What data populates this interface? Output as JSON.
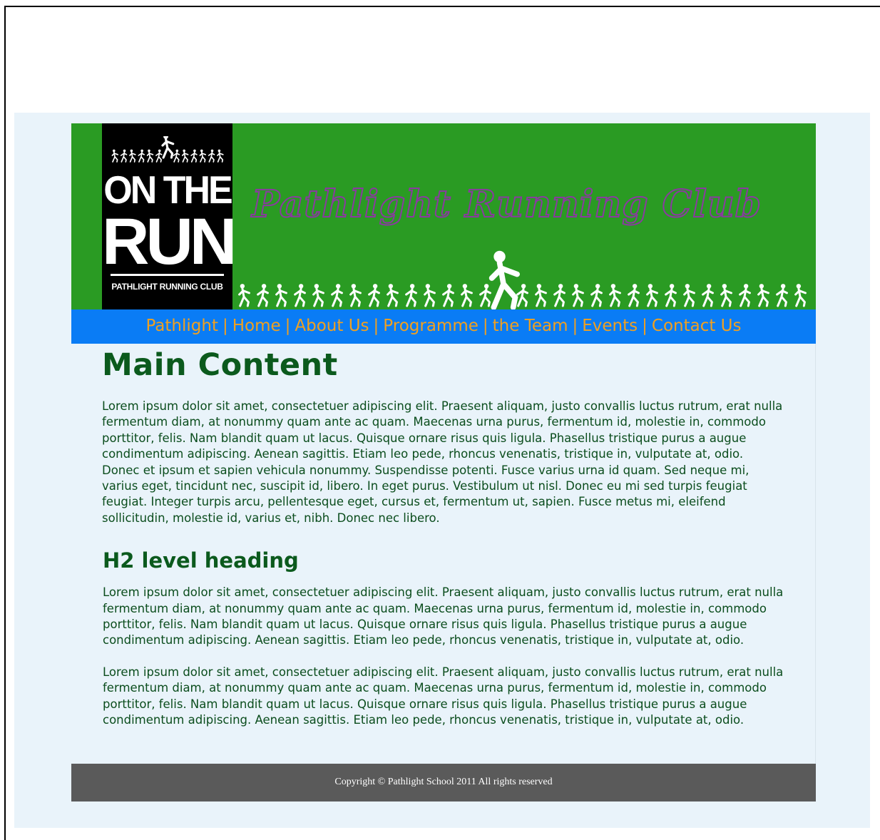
{
  "logo": {
    "line1": "ON THE",
    "line2": "RUN",
    "subtitle": "PATHLIGHT RUNNING CLUB"
  },
  "header": {
    "title": "Pathlight Running Club"
  },
  "nav": {
    "items": [
      {
        "label": "Pathlight"
      },
      {
        "label": "Home"
      },
      {
        "label": "About Us"
      },
      {
        "label": "Programme"
      },
      {
        "label": "the Team"
      },
      {
        "label": "Events"
      },
      {
        "label": "Contact Us"
      }
    ],
    "separator": "|"
  },
  "main": {
    "heading": "Main Content",
    "paragraph1": "Lorem ipsum dolor sit amet, consectetuer adipiscing elit. Praesent aliquam, justo convallis luctus rutrum, erat nulla fermentum diam, at nonummy quam ante ac quam. Maecenas urna purus, fermentum id, molestie in, commodo porttitor, felis. Nam blandit quam ut lacus. Quisque ornare risus quis ligula. Phasellus tristique purus a augue condimentum adipiscing. Aenean sagittis. Etiam leo pede, rhoncus venenatis, tristique in, vulputate at, odio. Donec et ipsum et sapien vehicula nonummy. Suspendisse potenti. Fusce varius urna id quam. Sed neque mi, varius eget, tincidunt nec, suscipit id, libero. In eget purus. Vestibulum ut nisl. Donec eu mi sed turpis feugiat feugiat. Integer turpis arcu, pellentesque eget, cursus et, fermentum ut, sapien. Fusce metus mi, eleifend sollicitudin, molestie id, varius et, nibh. Donec nec libero.",
    "subheading": "H2 level heading",
    "paragraph2": "Lorem ipsum dolor sit amet, consectetuer adipiscing elit. Praesent aliquam, justo convallis luctus rutrum, erat nulla fermentum diam, at nonummy quam ante ac quam. Maecenas urna purus, fermentum id, molestie in, commodo porttitor, felis. Nam blandit quam ut lacus. Quisque ornare risus quis ligula. Phasellus tristique purus a augue condimentum adipiscing. Aenean sagittis. Etiam leo pede, rhoncus venenatis, tristique in, vulputate at, odio.",
    "paragraph3": "Lorem ipsum dolor sit amet, consectetuer adipiscing elit. Praesent aliquam, justo convallis luctus rutrum, erat nulla fermentum diam, at nonummy quam ante ac quam. Maecenas urna purus, fermentum id, molestie in, commodo porttitor, felis. Nam blandit quam ut lacus. Quisque ornare risus quis ligula. Phasellus tristique purus a augue condimentum adipiscing. Aenean sagittis. Etiam leo pede, rhoncus venenatis, tristique in, vulputate at, odio."
  },
  "footer": {
    "copyright": "Copyright © Pathlight School 2011 All rights reserved"
  },
  "colors": {
    "header_green": "#2a9b23",
    "nav_blue": "#0a7cf5",
    "nav_text": "#f0a020",
    "title_outline": "#8a3aa0",
    "text_green": "#0b4d1d",
    "footer_gray": "#5a5a5a",
    "page_bg": "#e9f3fa"
  },
  "icons": {
    "logo_runners": "runner-silhouettes-icon",
    "header_runners": "runner-silhouettes-icon"
  }
}
